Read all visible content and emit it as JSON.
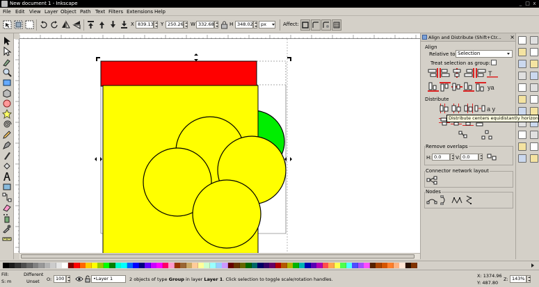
{
  "window": {
    "title": "New document 1 - Inkscape"
  },
  "menu": [
    "File",
    "Edit",
    "View",
    "Layer",
    "Object",
    "Path",
    "Text",
    "Filters",
    "Extensions",
    "Help"
  ],
  "toolbar": {
    "x_label": "X",
    "x_value": "839.133",
    "y_label": "Y",
    "y_value": "250.268",
    "w_label": "W",
    "w_value": "332.687",
    "h_label": "H",
    "h_value": "348.020",
    "unit": "px",
    "affect_label": "Affect:"
  },
  "dock": {
    "title": "Align and Distribute (Shift+Ctr...",
    "align_label": "Align",
    "relative_to_label": "Relative to:",
    "relative_to_value": "Selection",
    "treat_group_label": "Treat selection as group:",
    "distribute_label": "Distribute",
    "remove_overlaps_label": "Remove overlaps",
    "h_label": "H:",
    "h_value": "0.0",
    "v_label": "V:",
    "v_value": "0.0",
    "connector_label": "Connector network layout",
    "nodes_label": "Nodes"
  },
  "tooltip": "Distribute centers equidistantly horizontally",
  "status": {
    "fill_label": "Fill:",
    "fill_value": "Different",
    "stroke_label": "S:",
    "stroke_value": "m",
    "stroke_extra": "Unset",
    "opacity_label": "O:",
    "opacity_value": "100",
    "layer_value": "•Layer 1",
    "message_prefix": "2 objects of type ",
    "message_bold1": "Group",
    "message_mid": " in layer ",
    "message_bold2": "Layer 1",
    "message_suffix": ". Click selection to toggle scale/rotation handles.",
    "cursor_x": "X: 1374.96",
    "cursor_y": "Y:  487.80",
    "zoom_label": "Z:",
    "zoom_value": "143%"
  },
  "colors": {
    "red_rect": "#ff0000",
    "yellow": "#ffff00",
    "green": "#00ee00",
    "stroke": "#000000"
  },
  "palette": [
    "#000000",
    "#1a1a1a",
    "#333333",
    "#4d4d4d",
    "#666666",
    "#808080",
    "#999999",
    "#b3b3b3",
    "#cccccc",
    "#e6e6e6",
    "#ffffff",
    "#800000",
    "#ff0000",
    "#ff6600",
    "#ffcc00",
    "#ffff00",
    "#99cc00",
    "#00ff00",
    "#008000",
    "#00ffcc",
    "#00ffff",
    "#0066ff",
    "#0000ff",
    "#000080",
    "#6600ff",
    "#cc00ff",
    "#ff00ff",
    "#ff0066",
    "#ff99cc",
    "#993300",
    "#996633",
    "#ccaa66",
    "#ffcc99",
    "#ffff99",
    "#ccffcc",
    "#99ffff",
    "#99ccff",
    "#cc99ff",
    "#660000",
    "#663300",
    "#666600",
    "#006600",
    "#006666",
    "#000066",
    "#330066",
    "#660066",
    "#b30000",
    "#b35900",
    "#b3b300",
    "#00b300",
    "#00b3b3",
    "#0000b3",
    "#5900b3",
    "#b300b3",
    "#ff4d4d",
    "#ffa64d",
    "#ffff4d",
    "#4dff4d",
    "#4dffff",
    "#4d4dff",
    "#a64dff",
    "#ff4dff",
    "#552200",
    "#aa4400",
    "#d45500",
    "#ff7f2a",
    "#ffb380",
    "#ffe6d5",
    "#2b1100",
    "#803300"
  ]
}
